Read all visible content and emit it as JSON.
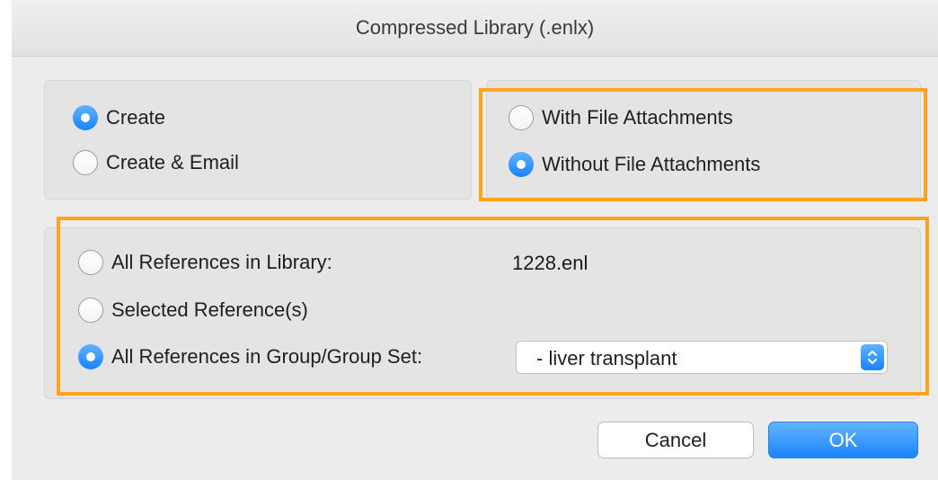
{
  "window": {
    "title": "Compressed Library (.enlx)"
  },
  "action_group": {
    "options": [
      {
        "label": "Create",
        "checked": true
      },
      {
        "label": "Create & Email",
        "checked": false
      }
    ]
  },
  "attachments_group": {
    "options": [
      {
        "label": "With File Attachments",
        "checked": false
      },
      {
        "label": "Without File Attachments",
        "checked": true
      }
    ]
  },
  "references_group": {
    "all_in_library": {
      "label": "All References in Library:",
      "checked": false,
      "value": "1228.enl"
    },
    "selected": {
      "label": "Selected Reference(s)",
      "checked": false
    },
    "group_set": {
      "label": "All References in Group/Group Set:",
      "checked": true,
      "selected_value": "- liver transplant"
    }
  },
  "buttons": {
    "cancel": "Cancel",
    "ok": "OK"
  },
  "colors": {
    "accent": "#1a82fb",
    "highlight": "#ffa21f"
  },
  "icons": {
    "select_arrow": "chevron-up-down-icon"
  }
}
